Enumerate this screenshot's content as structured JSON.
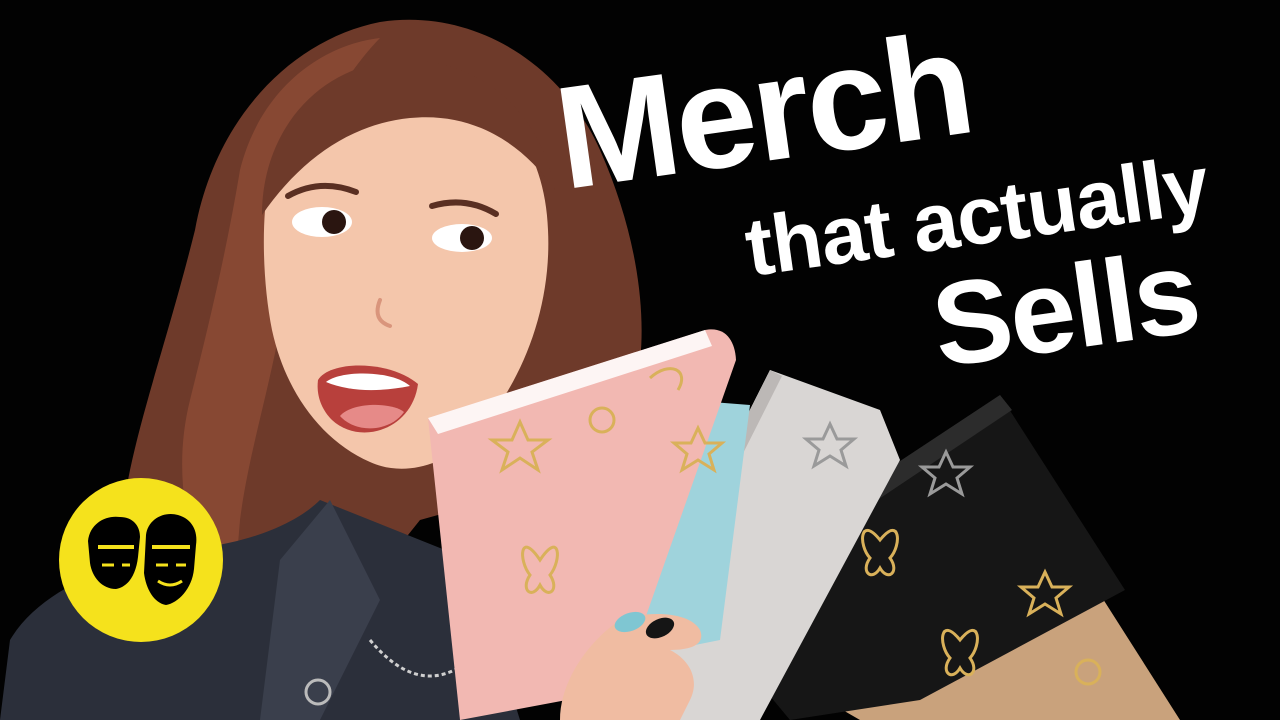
{
  "thumbnail": {
    "headline": {
      "line1": "Merch",
      "line2": "that actually",
      "line3": "Sells"
    },
    "colors": {
      "background": "#020202",
      "headline_text": "#ffffff",
      "logo_circle": "#f5e21c",
      "notebook_pink": "#f2b8b2",
      "notebook_blue": "#9fd3dc",
      "notebook_grey": "#d9d6d4",
      "notebook_black": "#161616",
      "notebook_tan": "#c9a27c",
      "foil_gold": "#d9b15a",
      "hair": "#7a4030",
      "skin": "#f4c4a8"
    },
    "icons": [
      "channel-logo-two-faces-icon",
      "star-icon",
      "butterfly-icon",
      "flower-icon"
    ]
  }
}
